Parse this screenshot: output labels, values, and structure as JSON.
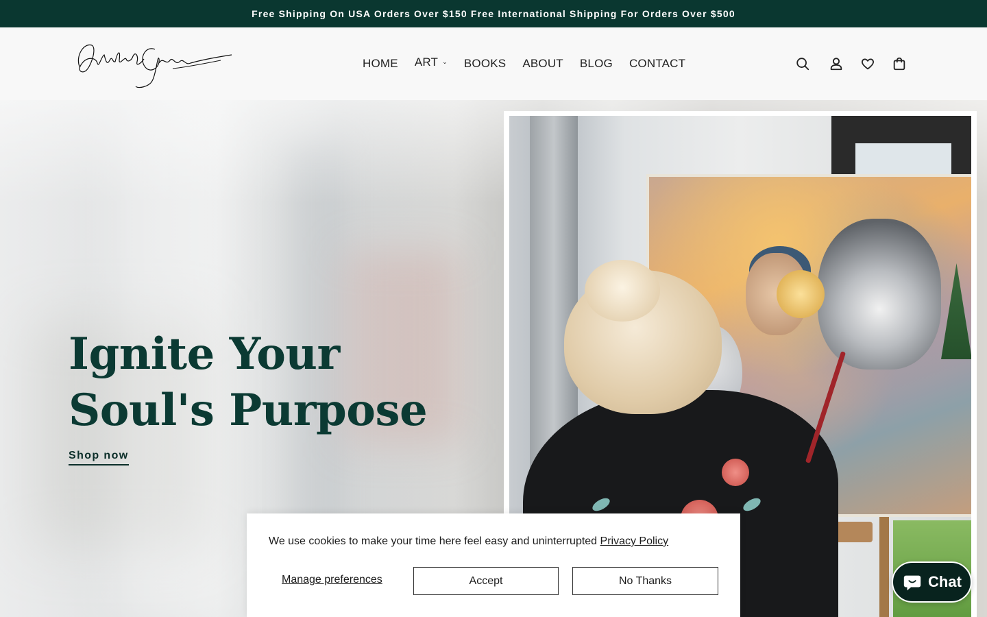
{
  "announcement": {
    "text": "Free Shipping On USA Orders Over $150 Free International Shipping For Orders Over $500"
  },
  "header": {
    "logo_alt": "Michelle Green signature logo",
    "nav": [
      {
        "label": "HOME"
      },
      {
        "label": "ART",
        "has_dropdown": true
      },
      {
        "label": "BOOKS"
      },
      {
        "label": "ABOUT"
      },
      {
        "label": "BLOG"
      },
      {
        "label": "CONTACT"
      }
    ],
    "icons": [
      "search-icon",
      "account-icon",
      "wishlist-heart-icon",
      "cart-bag-icon"
    ]
  },
  "hero": {
    "title_line1": "Ignite Your",
    "title_line2": "Soul's Purpose",
    "cta_label": "Shop now",
    "image_alt": "Artist painting a woman and wolf canvas on an easel"
  },
  "cookie_banner": {
    "message": "We use cookies to make your time here feel easy and uninterrupted",
    "privacy_link": "Privacy Policy",
    "manage_label": "Manage preferences",
    "accept_label": "Accept",
    "decline_label": "No Thanks"
  },
  "chat_widget": {
    "label": "Chat"
  },
  "colors": {
    "announcement_bg": "#0a3730",
    "title_color": "#0b3a33",
    "chat_bg": "#08231e"
  }
}
